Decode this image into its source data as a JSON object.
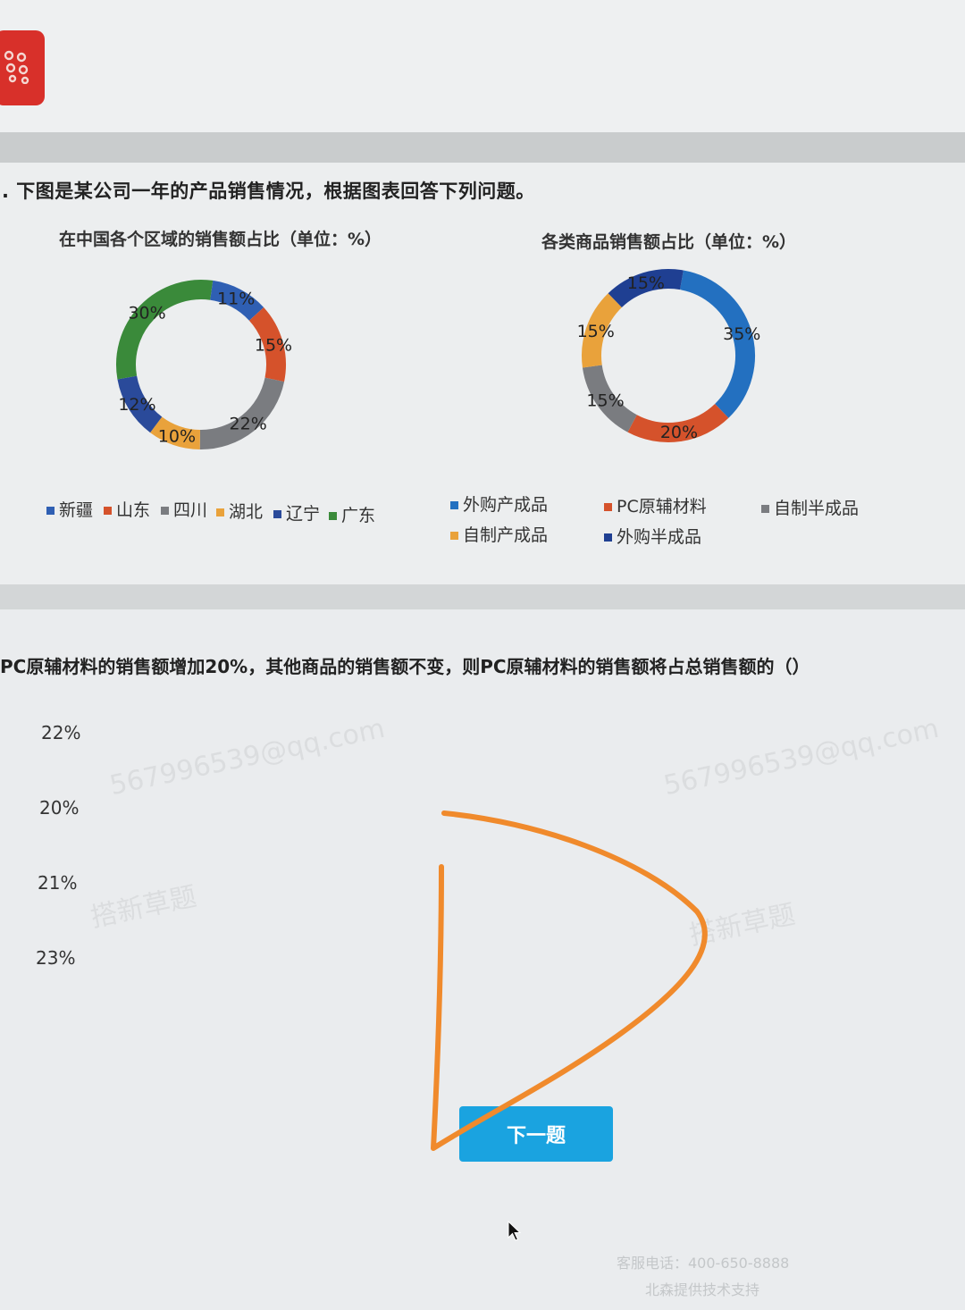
{
  "question": {
    "stem": "下图是某公司一年的产品销售情况，根据图表回答下列问题。",
    "sub_question": "PC原辅材料的销售额增加20%，其他商品的销售额不变，则PC原辅材料的销售额将占总销售额的（）",
    "options": [
      "22%",
      "20%",
      "21%",
      "23%"
    ]
  },
  "chart_data": [
    {
      "type": "pie",
      "title": "在中国各个区域的销售额占比（单位：%）",
      "categories": [
        "新疆",
        "山东",
        "四川",
        "湖北",
        "辽宁",
        "广东"
      ],
      "values": [
        11,
        15,
        22,
        10,
        12,
        30
      ],
      "labels": [
        "11%",
        "15%",
        "22%",
        "10%",
        "12%",
        "30%"
      ],
      "colors": [
        "#2f5fb3",
        "#d5522b",
        "#7a7c80",
        "#e9a23b",
        "#2a4a9a",
        "#3a8a3a"
      ],
      "legend_position": "bottom"
    },
    {
      "type": "pie",
      "title": "各类商品销售额占比（单位：%）",
      "categories": [
        "外购产成品",
        "PC原辅材料",
        "自制半成品",
        "自制产成品",
        "外购半成品"
      ],
      "values": [
        35,
        20,
        15,
        15,
        15
      ],
      "labels": [
        "35%",
        "20%",
        "15%",
        "15%",
        "15%"
      ],
      "colors": [
        "#2370c0",
        "#d5522b",
        "#7a7c80",
        "#e9a23b",
        "#1f3f92"
      ],
      "legend_position": "bottom"
    }
  ],
  "buttons": {
    "next_label": "下一题"
  },
  "watermarks": [
    "567996539@qq.com",
    "567996539@qq.com",
    "搭新草题",
    "搭新草题"
  ],
  "footer": {
    "phone": "客服电话：400-650-8888",
    "support": "北森提供技术支持"
  },
  "annotation_color": "#f08a2c",
  "accent": "#1aa3e0",
  "logo_color": "#d8302a"
}
